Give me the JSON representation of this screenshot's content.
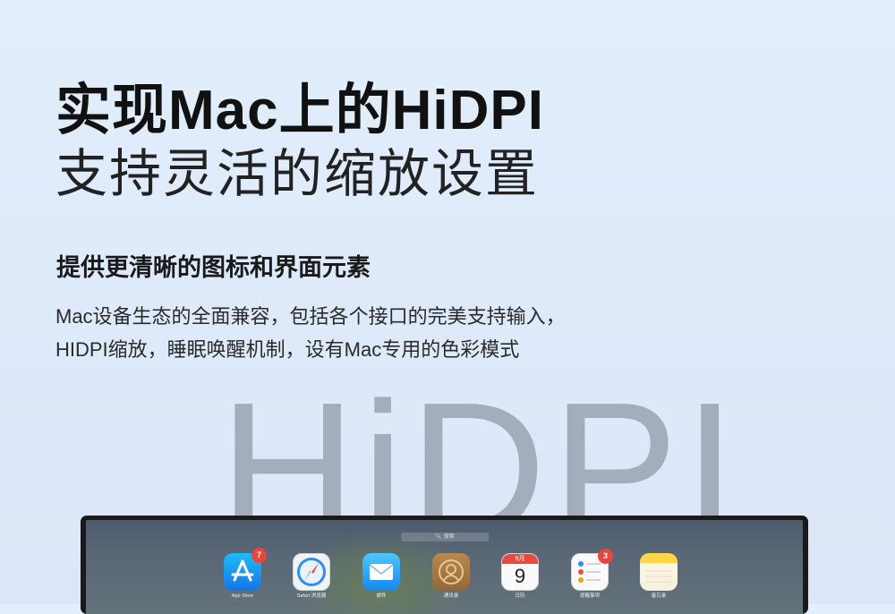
{
  "hero": {
    "headline": "实现Mac上的HiDPI",
    "subheadline": "支持灵活的缩放设置"
  },
  "feature": {
    "title": "提供更清晰的图标和界面元素",
    "description_lines": [
      "Mac设备生态的全面兼容，包括各个接口的完美支持输入，",
      "HIDPI缩放，睡眠唤醒机制，设有Mac专用的色彩模式"
    ]
  },
  "watermark": "HiDPI",
  "screen": {
    "search_placeholder": "搜索",
    "apps": [
      {
        "label": "App Store",
        "icon": "app-store-icon",
        "badge": "7"
      },
      {
        "label": "Safari 浏览器",
        "icon": "safari-icon"
      },
      {
        "label": "邮件",
        "icon": "mail-icon"
      },
      {
        "label": "通讯录",
        "icon": "contacts-icon"
      },
      {
        "label": "日历",
        "icon": "calendar-icon",
        "month": "9月",
        "day": "9"
      },
      {
        "label": "提醒事项",
        "icon": "reminders-icon",
        "badge": "3"
      },
      {
        "label": "备忘录",
        "icon": "notes-icon"
      }
    ]
  },
  "colors": {
    "background": "#e0ecfb",
    "watermark": "#a3adbb",
    "badge": "#e8453c"
  }
}
